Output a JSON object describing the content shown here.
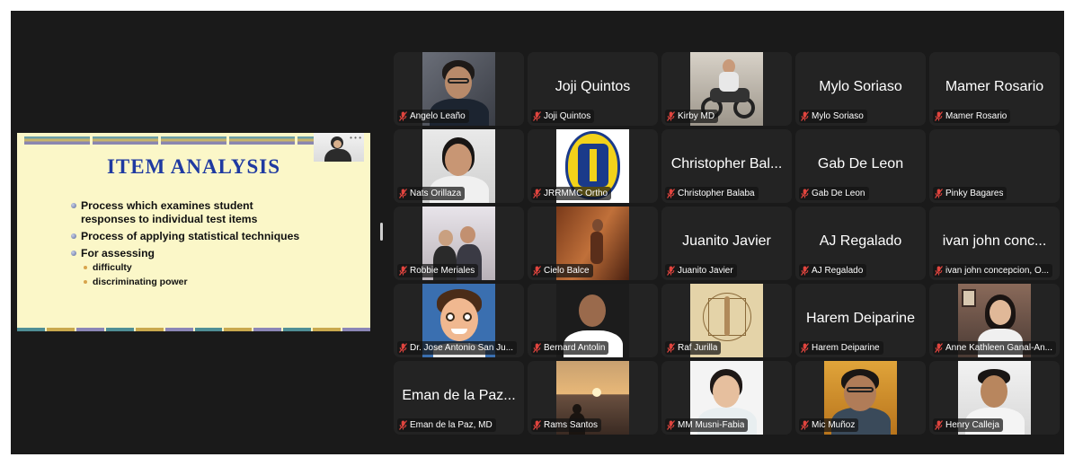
{
  "slide": {
    "title": "ITEM ANALYSIS",
    "bullets": [
      {
        "level": 1,
        "text": "Process which examines student"
      },
      {
        "level": 0,
        "text": "responses to individual test items"
      },
      {
        "level": 1,
        "text": "Process of applying statistical techniques"
      },
      {
        "level": 1,
        "text": "For assessing"
      },
      {
        "level": 2,
        "text": "difficulty"
      },
      {
        "level": 2,
        "text": "discriminating power"
      }
    ]
  },
  "participants": [
    {
      "name": "Angelo Leaño",
      "display": "",
      "video": "man-glasses",
      "muted": true
    },
    {
      "name": "Joji Quintos",
      "display": "Joji Quintos",
      "video": "",
      "muted": true
    },
    {
      "name": "Kirby MD",
      "display": "",
      "video": "motorcycle",
      "muted": true
    },
    {
      "name": "Mylo Soriaso",
      "display": "Mylo Soriaso",
      "video": "",
      "muted": true
    },
    {
      "name": "Mamer Rosario",
      "display": "Mamer Rosario",
      "video": "",
      "muted": true
    },
    {
      "name": "Nats Orillaza",
      "display": "",
      "video": "man-long-hair",
      "muted": true
    },
    {
      "name": "JRRMMC Ortho",
      "display": "",
      "video": "logo",
      "muted": true
    },
    {
      "name": "Christopher Balaba",
      "display": "Christopher Bal...",
      "video": "",
      "muted": true
    },
    {
      "name": "Gab De Leon",
      "display": "Gab De Leon",
      "video": "",
      "muted": true
    },
    {
      "name": "Pinky Bagares",
      "display": "",
      "video": "",
      "muted": true
    },
    {
      "name": "Robbie Meriales",
      "display": "",
      "video": "couple-blossoms",
      "muted": true
    },
    {
      "name": "Cielo Balce",
      "display": "",
      "video": "dancer",
      "muted": true
    },
    {
      "name": "Juanito Javier",
      "display": "Juanito Javier",
      "video": "",
      "muted": true
    },
    {
      "name": "AJ Regalado",
      "display": "AJ Regalado",
      "video": "",
      "muted": true
    },
    {
      "name": "ivan john concepcion, O...",
      "display": "ivan john conc...",
      "video": "",
      "muted": true
    },
    {
      "name": "Dr. Jose Antonio San Ju...",
      "display": "",
      "video": "cartoon",
      "muted": true
    },
    {
      "name": "Bernard Antolin",
      "display": "",
      "video": "man-bald",
      "muted": true
    },
    {
      "name": "Raf Jurilla",
      "display": "",
      "video": "vitruvian",
      "muted": true
    },
    {
      "name": "Harem Deiparine",
      "display": "Harem Deiparine",
      "video": "",
      "muted": true
    },
    {
      "name": "Anne Kathleen Ganal-An...",
      "display": "",
      "video": "woman-room",
      "muted": true
    },
    {
      "name": "Eman de la Paz, MD",
      "display": "Eman de la Paz...",
      "video": "",
      "muted": true
    },
    {
      "name": "Rams Santos",
      "display": "",
      "video": "sunset",
      "muted": true
    },
    {
      "name": "MM Musni-Fabia",
      "display": "",
      "video": "woman-white",
      "muted": true
    },
    {
      "name": "Mic Muñoz",
      "display": "",
      "video": "man-glasses-2",
      "muted": true
    },
    {
      "name": "Henry Calleja",
      "display": "",
      "video": "man-white-coat",
      "muted": true
    }
  ],
  "colors": {
    "muted": "#e0443e",
    "tile": "#232323",
    "background": "#1a1a1a"
  }
}
